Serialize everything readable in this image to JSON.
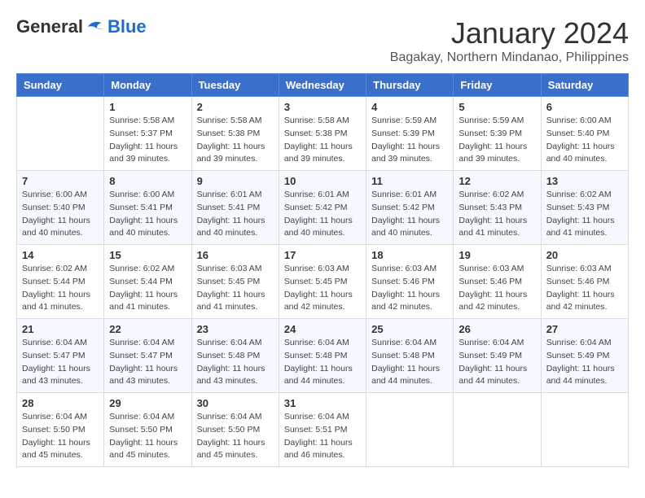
{
  "header": {
    "logo_general": "General",
    "logo_blue": "Blue",
    "month_title": "January 2024",
    "location": "Bagakay, Northern Mindanao, Philippines"
  },
  "weekdays": [
    "Sunday",
    "Monday",
    "Tuesday",
    "Wednesday",
    "Thursday",
    "Friday",
    "Saturday"
  ],
  "weeks": [
    [
      {
        "day": "",
        "sunrise": "",
        "sunset": "",
        "daylight": ""
      },
      {
        "day": "1",
        "sunrise": "Sunrise: 5:58 AM",
        "sunset": "Sunset: 5:37 PM",
        "daylight": "Daylight: 11 hours and 39 minutes."
      },
      {
        "day": "2",
        "sunrise": "Sunrise: 5:58 AM",
        "sunset": "Sunset: 5:38 PM",
        "daylight": "Daylight: 11 hours and 39 minutes."
      },
      {
        "day": "3",
        "sunrise": "Sunrise: 5:58 AM",
        "sunset": "Sunset: 5:38 PM",
        "daylight": "Daylight: 11 hours and 39 minutes."
      },
      {
        "day": "4",
        "sunrise": "Sunrise: 5:59 AM",
        "sunset": "Sunset: 5:39 PM",
        "daylight": "Daylight: 11 hours and 39 minutes."
      },
      {
        "day": "5",
        "sunrise": "Sunrise: 5:59 AM",
        "sunset": "Sunset: 5:39 PM",
        "daylight": "Daylight: 11 hours and 39 minutes."
      },
      {
        "day": "6",
        "sunrise": "Sunrise: 6:00 AM",
        "sunset": "Sunset: 5:40 PM",
        "daylight": "Daylight: 11 hours and 40 minutes."
      }
    ],
    [
      {
        "day": "7",
        "sunrise": "Sunrise: 6:00 AM",
        "sunset": "Sunset: 5:40 PM",
        "daylight": "Daylight: 11 hours and 40 minutes."
      },
      {
        "day": "8",
        "sunrise": "Sunrise: 6:00 AM",
        "sunset": "Sunset: 5:41 PM",
        "daylight": "Daylight: 11 hours and 40 minutes."
      },
      {
        "day": "9",
        "sunrise": "Sunrise: 6:01 AM",
        "sunset": "Sunset: 5:41 PM",
        "daylight": "Daylight: 11 hours and 40 minutes."
      },
      {
        "day": "10",
        "sunrise": "Sunrise: 6:01 AM",
        "sunset": "Sunset: 5:42 PM",
        "daylight": "Daylight: 11 hours and 40 minutes."
      },
      {
        "day": "11",
        "sunrise": "Sunrise: 6:01 AM",
        "sunset": "Sunset: 5:42 PM",
        "daylight": "Daylight: 11 hours and 40 minutes."
      },
      {
        "day": "12",
        "sunrise": "Sunrise: 6:02 AM",
        "sunset": "Sunset: 5:43 PM",
        "daylight": "Daylight: 11 hours and 41 minutes."
      },
      {
        "day": "13",
        "sunrise": "Sunrise: 6:02 AM",
        "sunset": "Sunset: 5:43 PM",
        "daylight": "Daylight: 11 hours and 41 minutes."
      }
    ],
    [
      {
        "day": "14",
        "sunrise": "Sunrise: 6:02 AM",
        "sunset": "Sunset: 5:44 PM",
        "daylight": "Daylight: 11 hours and 41 minutes."
      },
      {
        "day": "15",
        "sunrise": "Sunrise: 6:02 AM",
        "sunset": "Sunset: 5:44 PM",
        "daylight": "Daylight: 11 hours and 41 minutes."
      },
      {
        "day": "16",
        "sunrise": "Sunrise: 6:03 AM",
        "sunset": "Sunset: 5:45 PM",
        "daylight": "Daylight: 11 hours and 41 minutes."
      },
      {
        "day": "17",
        "sunrise": "Sunrise: 6:03 AM",
        "sunset": "Sunset: 5:45 PM",
        "daylight": "Daylight: 11 hours and 42 minutes."
      },
      {
        "day": "18",
        "sunrise": "Sunrise: 6:03 AM",
        "sunset": "Sunset: 5:46 PM",
        "daylight": "Daylight: 11 hours and 42 minutes."
      },
      {
        "day": "19",
        "sunrise": "Sunrise: 6:03 AM",
        "sunset": "Sunset: 5:46 PM",
        "daylight": "Daylight: 11 hours and 42 minutes."
      },
      {
        "day": "20",
        "sunrise": "Sunrise: 6:03 AM",
        "sunset": "Sunset: 5:46 PM",
        "daylight": "Daylight: 11 hours and 42 minutes."
      }
    ],
    [
      {
        "day": "21",
        "sunrise": "Sunrise: 6:04 AM",
        "sunset": "Sunset: 5:47 PM",
        "daylight": "Daylight: 11 hours and 43 minutes."
      },
      {
        "day": "22",
        "sunrise": "Sunrise: 6:04 AM",
        "sunset": "Sunset: 5:47 PM",
        "daylight": "Daylight: 11 hours and 43 minutes."
      },
      {
        "day": "23",
        "sunrise": "Sunrise: 6:04 AM",
        "sunset": "Sunset: 5:48 PM",
        "daylight": "Daylight: 11 hours and 43 minutes."
      },
      {
        "day": "24",
        "sunrise": "Sunrise: 6:04 AM",
        "sunset": "Sunset: 5:48 PM",
        "daylight": "Daylight: 11 hours and 44 minutes."
      },
      {
        "day": "25",
        "sunrise": "Sunrise: 6:04 AM",
        "sunset": "Sunset: 5:48 PM",
        "daylight": "Daylight: 11 hours and 44 minutes."
      },
      {
        "day": "26",
        "sunrise": "Sunrise: 6:04 AM",
        "sunset": "Sunset: 5:49 PM",
        "daylight": "Daylight: 11 hours and 44 minutes."
      },
      {
        "day": "27",
        "sunrise": "Sunrise: 6:04 AM",
        "sunset": "Sunset: 5:49 PM",
        "daylight": "Daylight: 11 hours and 44 minutes."
      }
    ],
    [
      {
        "day": "28",
        "sunrise": "Sunrise: 6:04 AM",
        "sunset": "Sunset: 5:50 PM",
        "daylight": "Daylight: 11 hours and 45 minutes."
      },
      {
        "day": "29",
        "sunrise": "Sunrise: 6:04 AM",
        "sunset": "Sunset: 5:50 PM",
        "daylight": "Daylight: 11 hours and 45 minutes."
      },
      {
        "day": "30",
        "sunrise": "Sunrise: 6:04 AM",
        "sunset": "Sunset: 5:50 PM",
        "daylight": "Daylight: 11 hours and 45 minutes."
      },
      {
        "day": "31",
        "sunrise": "Sunrise: 6:04 AM",
        "sunset": "Sunset: 5:51 PM",
        "daylight": "Daylight: 11 hours and 46 minutes."
      },
      {
        "day": "",
        "sunrise": "",
        "sunset": "",
        "daylight": ""
      },
      {
        "day": "",
        "sunrise": "",
        "sunset": "",
        "daylight": ""
      },
      {
        "day": "",
        "sunrise": "",
        "sunset": "",
        "daylight": ""
      }
    ]
  ]
}
